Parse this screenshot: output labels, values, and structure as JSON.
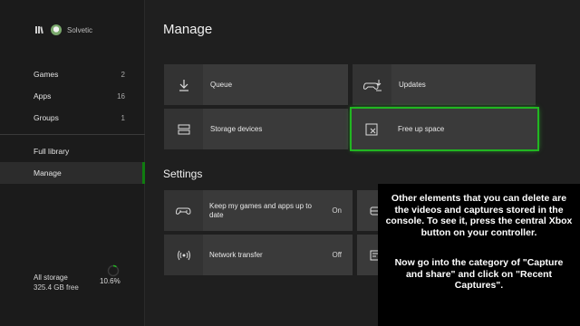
{
  "sidebar": {
    "brand_name": "Solvetic",
    "items": [
      {
        "label": "Games",
        "count": "2"
      },
      {
        "label": "Apps",
        "count": "16"
      },
      {
        "label": "Groups",
        "count": "1"
      },
      {
        "label": "Full library",
        "count": ""
      },
      {
        "label": "Manage",
        "count": ""
      }
    ],
    "storage": {
      "label": "All storage",
      "free": "325.4 GB free",
      "percent_text": "10.6%",
      "percent": 10.6
    }
  },
  "main": {
    "title": "Manage",
    "tiles": [
      {
        "label": "Queue",
        "icon": "download-icon"
      },
      {
        "label": "Updates",
        "icon": "controller-update-icon"
      },
      {
        "label": "Storage devices",
        "icon": "storage-drive-icon"
      },
      {
        "label": "Free up space",
        "icon": "free-space-icon"
      }
    ],
    "settings_title": "Settings",
    "settings": [
      {
        "label": "Keep my games and apps up to date",
        "value": "On",
        "icon": "controller-sync-icon"
      },
      {
        "label": "Network transfer",
        "value": "Off",
        "icon": "network-transfer-icon"
      }
    ]
  },
  "caption": {
    "paragraph1": "Other elements that you can delete are the videos and captures stored in the console. To see it, press the central Xbox button on your controller.",
    "paragraph2": "Now go into the category of \"Capture and share\" and click on \"Recent Captures\"."
  },
  "colors": {
    "accent": "#107c10",
    "focus": "#21b721",
    "background": "#1f1f1f",
    "tile": "#3a3a3a"
  }
}
